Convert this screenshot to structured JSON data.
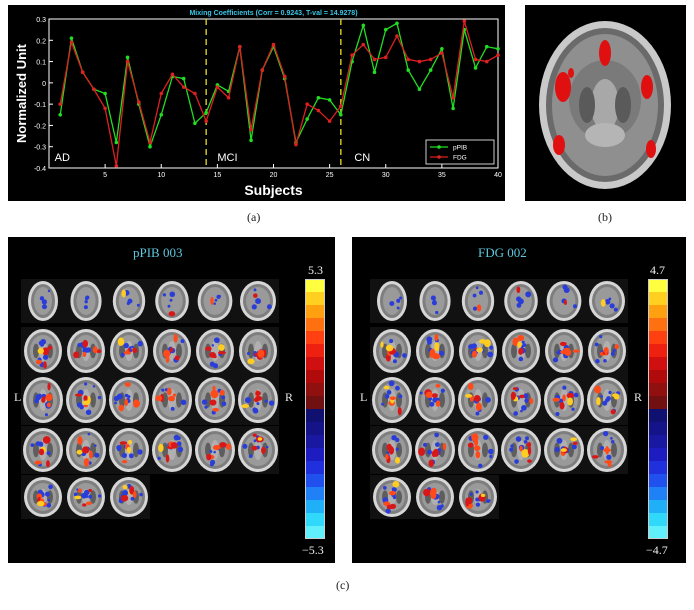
{
  "captions": {
    "a": "(a)",
    "b": "(b)",
    "c": "(c)"
  },
  "chart": {
    "title": "Mixing Coefficients (Corr = 0.9243, T-val = 14.9278)",
    "ylabel": "Normalized Unit",
    "xlabel": "Subjects",
    "yticks": [
      "0.3",
      "0.2",
      "0.1",
      "0",
      "-0.1",
      "-0.2",
      "-0.3",
      "-0.4"
    ],
    "xticks": [
      "5",
      "10",
      "15",
      "20",
      "25",
      "30",
      "35",
      "40"
    ],
    "groups": [
      "AD",
      "MCI",
      "CN"
    ],
    "legend": [
      "pPIB",
      "FDG"
    ]
  },
  "chart_data": {
    "type": "line",
    "title": "Mixing Coefficients (Corr = 0.9243, T-val = 14.9278)",
    "xlabel": "Subjects",
    "ylabel": "Normalized Unit",
    "xlim": [
      0,
      40
    ],
    "ylim": [
      -0.4,
      0.3
    ],
    "group_boundaries": [
      14,
      26
    ],
    "x": [
      1,
      2,
      3,
      4,
      5,
      6,
      7,
      8,
      9,
      10,
      11,
      12,
      13,
      14,
      15,
      16,
      17,
      18,
      19,
      20,
      21,
      22,
      23,
      24,
      25,
      26,
      27,
      28,
      29,
      30,
      31,
      32,
      33,
      34,
      35,
      36,
      37,
      38,
      39,
      40
    ],
    "series": [
      {
        "name": "pPIB",
        "color": "#22dd22",
        "values": [
          -0.15,
          0.21,
          0.05,
          -0.03,
          -0.05,
          -0.28,
          0.12,
          -0.1,
          -0.3,
          -0.15,
          0.03,
          0.02,
          -0.19,
          -0.14,
          -0.01,
          -0.04,
          0.17,
          -0.27,
          0.06,
          0.17,
          0.02,
          -0.28,
          -0.17,
          -0.07,
          -0.08,
          -0.15,
          0.1,
          0.27,
          0.05,
          0.25,
          0.28,
          0.06,
          -0.03,
          0.06,
          0.16,
          -0.12,
          0.25,
          0.07,
          0.17,
          0.16
        ]
      },
      {
        "name": "FDG",
        "color": "#dd2020",
        "values": [
          -0.1,
          0.19,
          0.05,
          -0.03,
          -0.12,
          -0.39,
          0.1,
          -0.09,
          -0.28,
          -0.05,
          0.04,
          -0.02,
          -0.05,
          -0.18,
          -0.02,
          -0.07,
          0.17,
          -0.22,
          0.06,
          0.18,
          0.03,
          -0.29,
          -0.1,
          -0.13,
          -0.18,
          -0.11,
          0.13,
          0.18,
          0.11,
          0.12,
          0.22,
          0.11,
          0.1,
          0.11,
          0.14,
          -0.07,
          0.29,
          0.11,
          0.1,
          0.13
        ]
      }
    ]
  },
  "maps": {
    "pib": {
      "title": "pPIB 003",
      "max": "5.3",
      "min": "−5.3"
    },
    "fdg": {
      "title": "FDG 002",
      "max": "4.7",
      "min": "−4.7"
    },
    "left": "L",
    "right": "R"
  }
}
